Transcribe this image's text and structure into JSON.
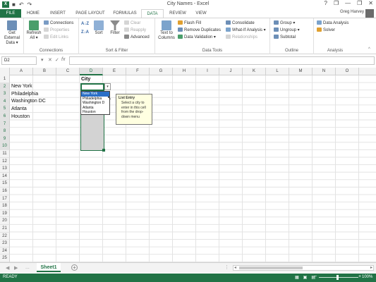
{
  "titlebar": {
    "app_icon": "X",
    "title": "City Names - Excel",
    "qat": [
      "save-icon",
      "undo-icon",
      "redo-icon"
    ],
    "controls": [
      "?",
      "❐",
      "—",
      "❐",
      "✕"
    ]
  },
  "tabs": [
    {
      "label": "FILE"
    },
    {
      "label": "HOME"
    },
    {
      "label": "INSERT"
    },
    {
      "label": "PAGE LAYOUT"
    },
    {
      "label": "FORMULAS"
    },
    {
      "label": "DATA"
    },
    {
      "label": "REVIEW"
    },
    {
      "label": "VIEW"
    }
  ],
  "user": "Greg Harvey",
  "ribbon": {
    "get_external": {
      "line1": "Get External",
      "line2": "Data ▾"
    },
    "refresh": {
      "line1": "Refresh",
      "line2": "All ▾"
    },
    "connections": "Connections",
    "properties": "Properties",
    "edit_links": "Edit Links",
    "group_connections": "Connections",
    "sort_az": "A↓Z",
    "sort_za": "Z↓A",
    "sort": "Sort",
    "filter": "Filter",
    "clear": "Clear",
    "reapply": "Reapply",
    "advanced": "Advanced",
    "group_sortfilter": "Sort & Filter",
    "text_to_columns": {
      "line1": "Text to",
      "line2": "Columns"
    },
    "flash_fill": "Flash Fill",
    "remove_duplicates": "Remove Duplicates",
    "data_validation": "Data Validation ▾",
    "consolidate": "Consolidate",
    "what_if": "What-If Analysis ▾",
    "relationships": "Relationships",
    "group_datatools": "Data Tools",
    "group_btn": "Group ▾",
    "ungroup_btn": "Ungroup ▾",
    "subtotal": "Subtotal",
    "group_outline": "Outline",
    "data_analysis": "Data Analysis",
    "solver": "Solver",
    "group_analysis": "Analysis"
  },
  "formula_bar": {
    "name_box": "D2",
    "cancel": "✕",
    "enter": "✓",
    "fx": "fx",
    "value": ""
  },
  "grid": {
    "columns": [
      "A",
      "B",
      "C",
      "D",
      "E",
      "F",
      "G",
      "H",
      "I",
      "J",
      "K",
      "L",
      "M",
      "N",
      "O"
    ],
    "selected_column": "D",
    "rows": [
      "1",
      "2",
      "3",
      "4",
      "5",
      "6",
      "7",
      "8",
      "9",
      "10",
      "11",
      "12",
      "13",
      "14",
      "15",
      "16",
      "17",
      "18",
      "19",
      "20",
      "21",
      "22",
      "23",
      "24",
      "25"
    ],
    "cells": {
      "d1": "City",
      "a2": "New York",
      "a3": "Philadelphia",
      "a4": "Washington DC",
      "a5": "Atlanta",
      "a6": "Houston"
    }
  },
  "dropdown": {
    "arrow": "▾",
    "items": [
      "New York",
      "Philadelphia",
      "Washington D",
      "Atlanta",
      "Houston"
    ],
    "highlighted_index": 0
  },
  "tooltip": {
    "title": "List Entry",
    "body": [
      "Select a city to",
      "enter in this cell",
      "from the drop-",
      "down menu"
    ]
  },
  "sheetbar": {
    "prev": "◀",
    "next": "▶",
    "ellipsis": "...",
    "sheet_name": "Sheet1",
    "add": "+"
  },
  "status": {
    "ready": "READY",
    "zoom": "100%",
    "zoom_minus": "−",
    "zoom_plus": "+",
    "view_icons": [
      "normal-view-icon",
      "page-layout-icon",
      "page-break-icon"
    ]
  },
  "colors": {
    "excel_green": "#217346",
    "highlight_blue": "#2a6fc8",
    "tooltip_bg": "#ffffe1"
  }
}
